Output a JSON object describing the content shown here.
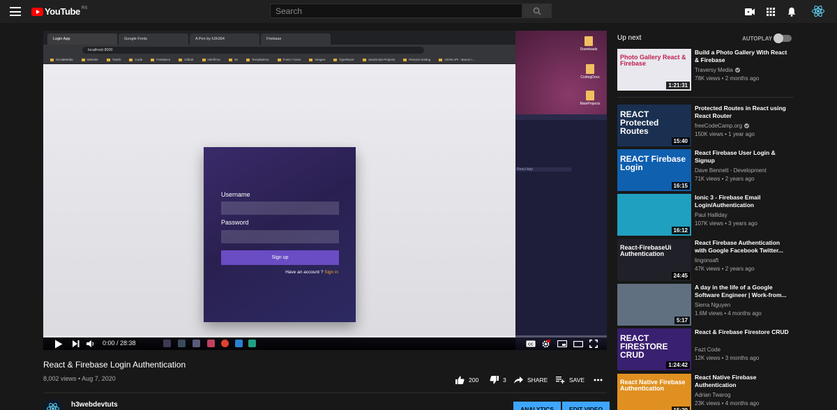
{
  "header": {
    "logo_text": "YouTube",
    "logo_region": "RS",
    "search_placeholder": "Search"
  },
  "player": {
    "time": "0:00 / 28:38",
    "progress_fraction": 0.0,
    "browser": {
      "tabs": [
        "Login App",
        "Google Fonts",
        "A Pen by h3h394",
        "Firebase"
      ],
      "url": "localhost:3000",
      "bookmarks": [
        "SocialMedia",
        "Website",
        "Twitch",
        "Code",
        "Freelance",
        "Github",
        "Html/Css",
        "JS",
        "Templatemo",
        "Fonts / Icons",
        "Images",
        "TypeRacer",
        "JavaScript Projects",
        "ReactJs testing",
        "JSON API - Bacon I..."
      ]
    },
    "login_form": {
      "username_label": "Username",
      "password_label": "Password",
      "signup_button": "Sign up",
      "footer_text": "Have an account ?",
      "signin_link": "Sign in"
    },
    "desktop_icons": [
      "Downloads",
      "CodingDocs",
      "MainProjects"
    ],
    "ide_label": "React App"
  },
  "video": {
    "title": "React & Firebase Login Authentication",
    "meta": "8,002 views • Aug 7, 2020",
    "likes": "200",
    "dislikes": "3",
    "share_label": "SHARE",
    "save_label": "SAVE",
    "channel_name": "h3webdevtuts",
    "analytics_label": "ANALYTICS",
    "edit_label": "EDIT VIDEO"
  },
  "sidebar": {
    "up_next": "Up next",
    "autoplay": "AUTOPLAY",
    "autoplay_on": false,
    "recommendations": [
      {
        "title": "Build a Photo Gallery With React & Firebase",
        "channel": "Traversy Media",
        "verified": true,
        "meta": "78K views • 2 months ago",
        "duration": "1:21:31",
        "thumb_text": "Photo Gallery React & Firebase",
        "color": "#e8e8ee"
      },
      {
        "title": "Protected Routes in React using React Router",
        "channel": "freeCodeCamp.org",
        "verified": true,
        "meta": "150K views • 1 year ago",
        "duration": "15:40",
        "thumb_text": "REACT Protected Routes",
        "color": "#1a3050"
      },
      {
        "title": "React Firebase User Login & Signup",
        "channel": "Dave Bennett - Development",
        "verified": false,
        "meta": "71K views • 2 years ago",
        "duration": "16:15",
        "thumb_text": "REACT Firebase Login",
        "color": "#1060b0"
      },
      {
        "title": "Ionic 3 - Firebase Email Login/Authentication",
        "channel": "Paul Halliday",
        "verified": false,
        "meta": "107K views • 3 years ago",
        "duration": "16:12",
        "thumb_text": "",
        "color": "#20a0c0"
      },
      {
        "title": "React Firebase Authentication with Google Facebook Twitter...",
        "channel": "lingonsaft",
        "verified": false,
        "meta": "47K views • 2 years ago",
        "duration": "24:45",
        "thumb_text": "React-FirebaseUi Authentication",
        "color": "#202028"
      },
      {
        "title": "A day in the life of a Google Software Engineer | Work-from...",
        "channel": "Sierra Nguyen",
        "verified": false,
        "meta": "1.6M views • 4 months ago",
        "duration": "5:17",
        "thumb_text": "",
        "color": "#607080"
      },
      {
        "title": "React & Firebase Firestore CRUD",
        "channel": "Fazt Code",
        "verified": false,
        "meta": "12K views • 3 months ago",
        "duration": "1:24:42",
        "thumb_text": "REACT FIRESTORE CRUD",
        "color": "#3a2070"
      },
      {
        "title": "React Native Firebase Authentication",
        "channel": "Adrian Twarog",
        "verified": false,
        "meta": "23K views • 4 months ago",
        "duration": "15:29",
        "thumb_text": "React Native Firebase Authentication",
        "color": "#e09020"
      }
    ]
  },
  "colors": {
    "background": "#181818",
    "topbar": "#202020",
    "accent_blue": "#3ea6ff",
    "youtube_red": "#ff0000",
    "signup_purple": "#6a4cc4"
  }
}
